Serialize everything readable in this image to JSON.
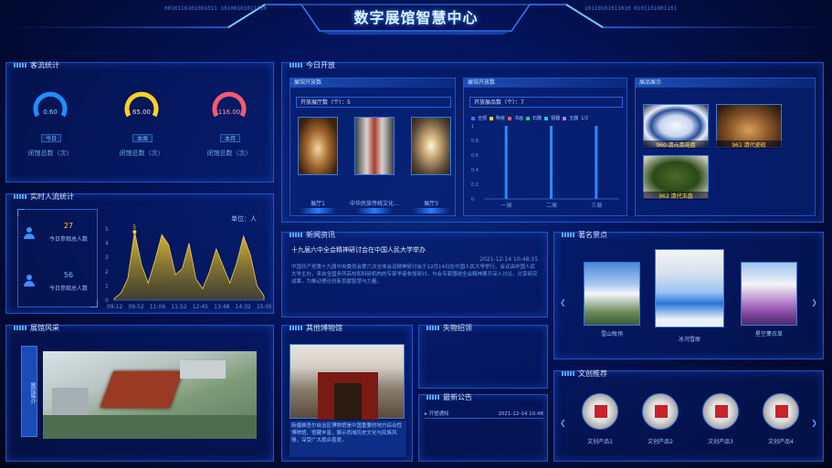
{
  "header": {
    "title": "数字展馆智慧中心",
    "binary_left": "0010110101001011 10100101011010",
    "binary_right": "10110101011010 0101101001101"
  },
  "visitor_stats": {
    "title": "客流统计",
    "gauges": [
      {
        "value": "0.60",
        "tag": "今日",
        "label": "闭馆总数（次）",
        "color": "#1e8fff"
      },
      {
        "value": "65.00",
        "tag": "本周",
        "label": "闭馆总数（次）",
        "color": "#ffd21e"
      },
      {
        "value": "116.00",
        "tag": "本月",
        "label": "闭馆总数（次）",
        "color": "#ff5a6e"
      }
    ]
  },
  "realtime": {
    "title": "实时人流统计",
    "unit": "单位：人",
    "stats": [
      {
        "value": "27",
        "label": "今日参观总人数"
      },
      {
        "value": "56",
        "label": "今日参观总人数"
      }
    ],
    "peak_label": "5",
    "y_ticks": [
      "0",
      "1",
      "2",
      "3",
      "4",
      "5"
    ],
    "x_ticks": [
      "09:12",
      "09:52",
      "11:06",
      "11:52",
      "12:45",
      "13:48",
      "14:32",
      "15:08"
    ]
  },
  "chart_data": {
    "type": "area",
    "title": "",
    "xlabel": "",
    "ylabel": "单位：人",
    "x": [
      "09:12",
      "09:52",
      "11:06",
      "11:52",
      "12:45",
      "13:48",
      "14:32",
      "15:08"
    ],
    "ylim": [
      0,
      5
    ],
    "values": [
      0.1,
      0.5,
      1.5,
      4.8,
      2.5,
      1.2,
      2.8,
      4.6,
      3.9,
      1.8,
      2.2,
      4.0,
      1.5,
      0.8,
      2.0,
      3.6,
      2.4,
      1.2,
      2.6,
      4.5,
      3.2,
      1.0,
      0.3
    ]
  },
  "venue": {
    "title": "展馆风采",
    "side_label": "展馆简介"
  },
  "today_open": {
    "title": "今日开放",
    "sections": [
      {
        "head": "展馆开放数",
        "stat": "开放展厅数（个）：5",
        "captions": [
          "展厅1",
          "中华民族传统文化…",
          "展厅3"
        ]
      },
      {
        "head": "展馆开放数",
        "stat": "开放展品数（个）：7",
        "legend": [
          "全部",
          "陶瓷",
          "书画",
          "石器",
          "铜器",
          "玉器"
        ],
        "page": "1/2",
        "y_ticks": [
          "0",
          "0.2",
          "0.4",
          "0.6",
          "0.8",
          "1"
        ],
        "x_ticks": [
          "一展",
          "二展",
          "三展"
        ]
      },
      {
        "head": "展品展示",
        "items": [
          "960 清元青花盘",
          "961 清代瓷砚",
          "962 清代玉盘"
        ]
      }
    ]
  },
  "news": {
    "title": "新闻资讯",
    "headline": "十九届六中全会精神研讨会在中国人民大学举办",
    "date": "2021-12-14 10:48:15",
    "body": "中国共产党第十九届中央委员会第六次全体会议精神研讨会于12月14日在中国人民大学举行。会议由中国人民大学主办，来自全国多所高校和科研机构的专家学者参加研讨。与会专家围绕全会精神展开深入讨论，分享研究成果，为推动理论创新贡献智慧与力量。"
  },
  "famous": {
    "title": "著名景点",
    "items": [
      "雪山牧场",
      "冰河雪原",
      "星空薰衣草"
    ]
  },
  "other": {
    "title": "其他博物馆",
    "caption": "新疆维吾尔自治区博物馆是中国重要的地方综合性博物馆，馆藏丰富，展示西域历史文化与民族风情，深受广大观众喜爱。"
  },
  "lost": {
    "title": "失物招领"
  },
  "notice": {
    "title": "最新公告",
    "item": "开馆通知",
    "date": "2021-12-14 10:48"
  },
  "cultural": {
    "title": "文创推荐",
    "items": [
      "文创产品1",
      "文创产品2",
      "文创产品3",
      "文创产品4"
    ]
  }
}
